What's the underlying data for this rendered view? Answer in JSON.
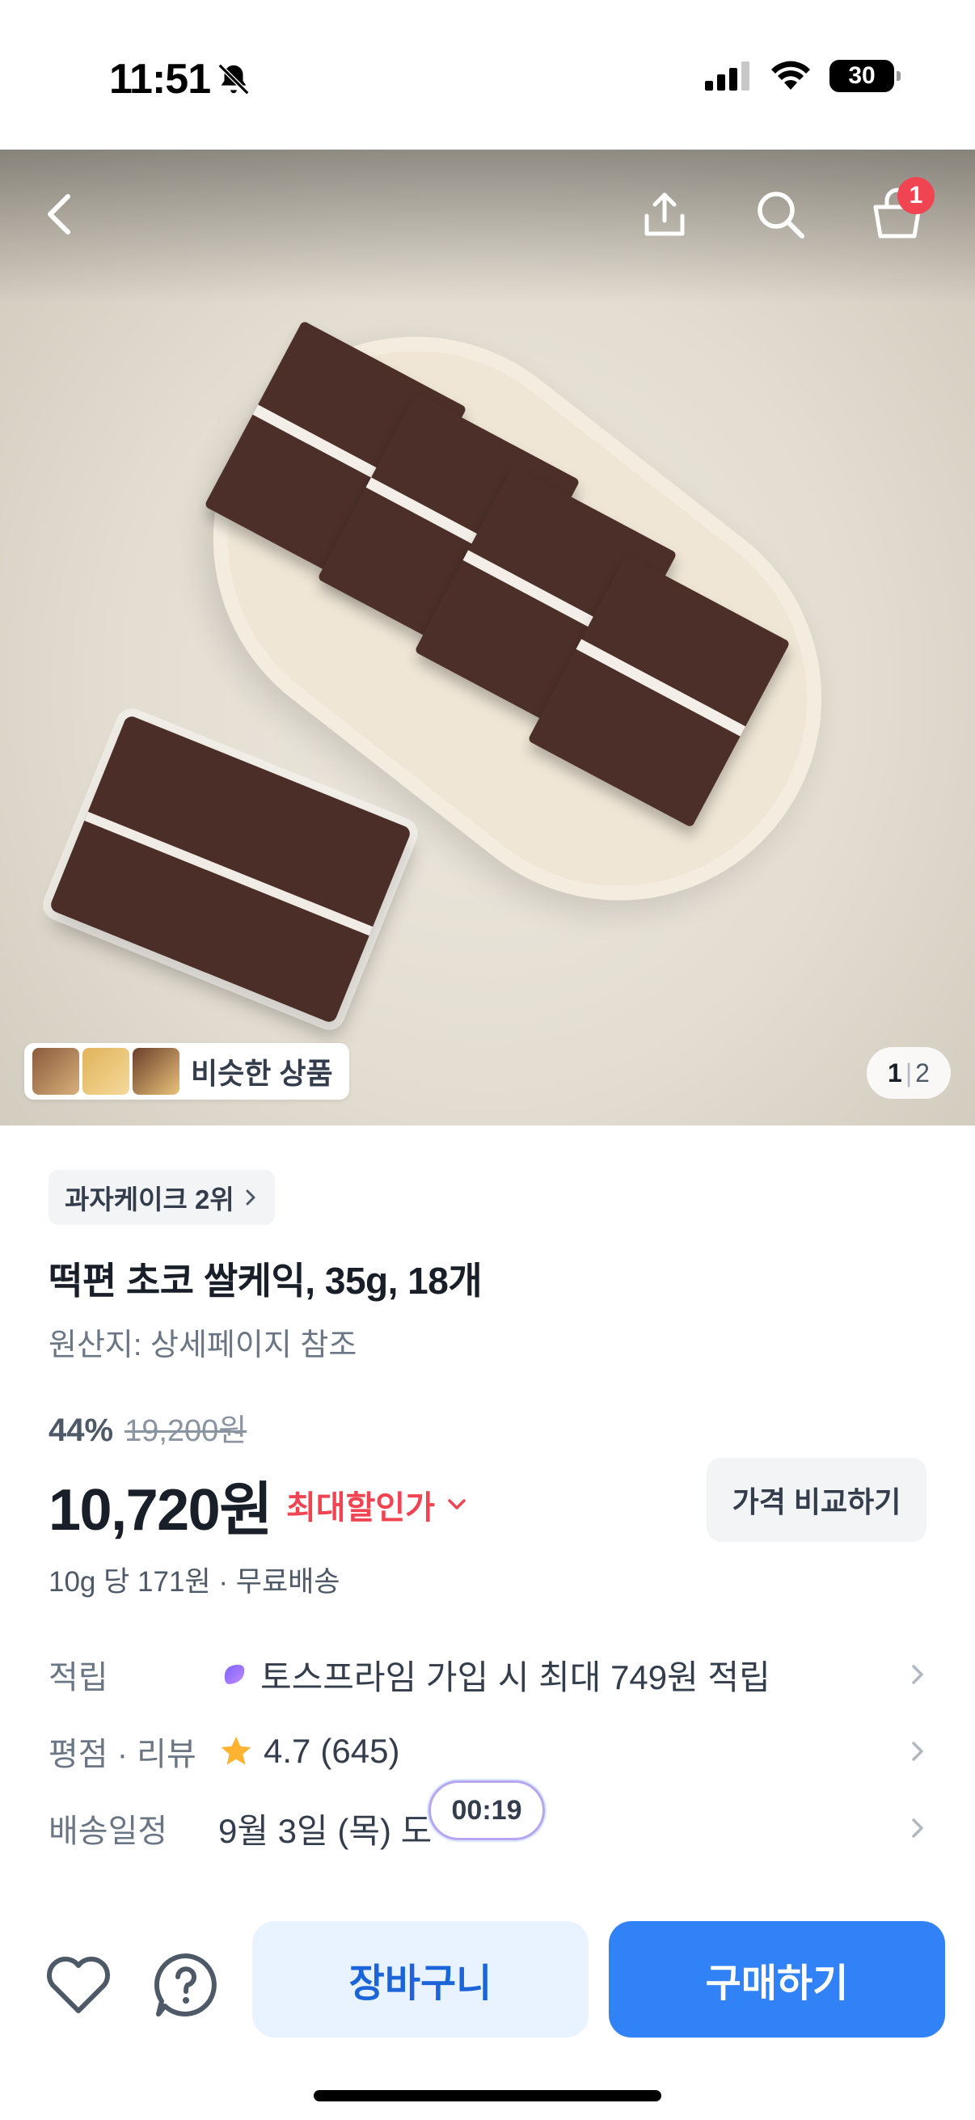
{
  "status_bar": {
    "time": "11:51",
    "battery": "30"
  },
  "hero": {
    "cart_count": "1",
    "similar_label": "비슷한 상품",
    "page_current": "1",
    "page_sep": "|",
    "page_total": "2"
  },
  "product": {
    "rank": "과자케이크 2위",
    "title": "떡편 초코 쌀케익, 35g, 18개",
    "origin": "원산지: 상세페이지 참조",
    "discount_pct": "44%",
    "original_price": "19,200원",
    "price": "10,720원",
    "max_discount_label": "최대할인가",
    "compare_label": "가격 비교하기",
    "unit_price": "10g 당 171원 · 무료배송"
  },
  "info_rows": [
    {
      "label": "적립",
      "value": "토스프라임 가입 시 최대 749원 적립"
    },
    {
      "label": "평점 · 리뷰",
      "rating": "4.7",
      "reviews": "(645)"
    },
    {
      "label": "배송일정",
      "value": "9월 3일 (목) 도"
    }
  ],
  "timer": "00:19",
  "bottom": {
    "cart_label": "장바구니",
    "buy_label": "구매하기"
  },
  "colors": {
    "accent": "#3182f6",
    "red": "#f04452",
    "star": "#ffb331"
  }
}
